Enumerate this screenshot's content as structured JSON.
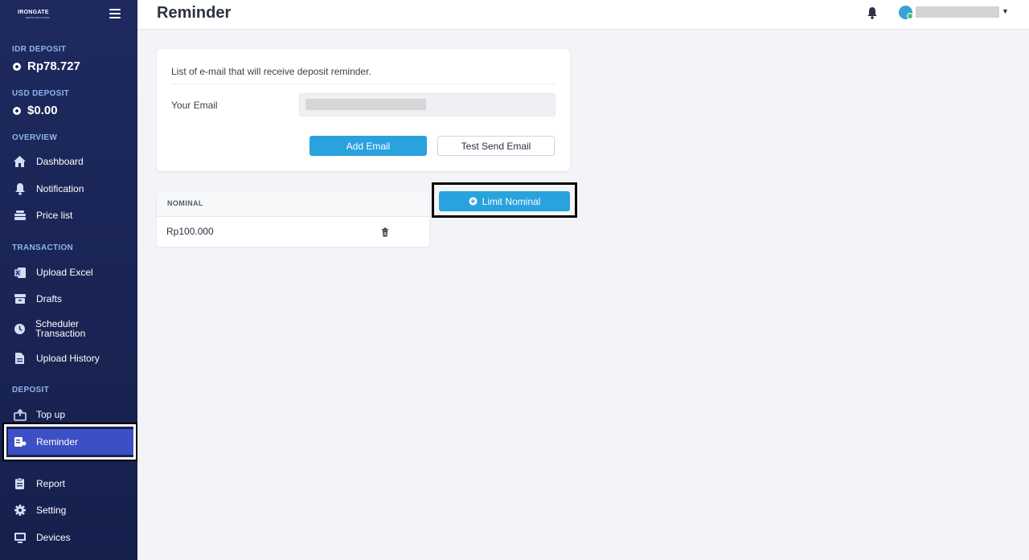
{
  "brand": {
    "name": "IRONGATE",
    "tagline": "DIGITAL SOLUTIONS"
  },
  "sidebar": {
    "idr": {
      "label": "IDR DEPOSIT",
      "amount": "Rp78.727"
    },
    "usd": {
      "label": "USD DEPOSIT",
      "amount": "$0.00"
    },
    "sections": {
      "overview": "OVERVIEW",
      "transaction": "TRANSACTION",
      "deposit": "DEPOSIT"
    },
    "items": [
      {
        "label": "Dashboard",
        "icon": "home-icon"
      },
      {
        "label": "Notification",
        "icon": "bell-icon"
      },
      {
        "label": "Price list",
        "icon": "layers-icon"
      },
      {
        "label": "Upload Excel",
        "icon": "excel-icon"
      },
      {
        "label": "Drafts",
        "icon": "archive-icon"
      },
      {
        "label": "Scheduler Transaction",
        "icon": "clock-icon"
      },
      {
        "label": "Upload History",
        "icon": "document-icon"
      },
      {
        "label": "Top up",
        "icon": "topup-icon"
      },
      {
        "label": "Reminder",
        "icon": "reminder-icon",
        "active": true
      },
      {
        "label": "Report",
        "icon": "clipboard-icon"
      },
      {
        "label": "Setting",
        "icon": "gear-icon"
      },
      {
        "label": "Devices",
        "icon": "monitor-icon"
      }
    ]
  },
  "header": {
    "title": "Reminder"
  },
  "reminder_card": {
    "description": "List of e-mail that will receive deposit reminder.",
    "email_label": "Your Email",
    "add_email_label": "Add Email",
    "test_send_label": "Test Send Email"
  },
  "limit_button": {
    "label": "Limit Nominal"
  },
  "nominal_table": {
    "header": "NOMINAL",
    "rows": [
      {
        "value": "Rp100.000"
      }
    ]
  },
  "colors": {
    "sidebar": "#1e2a5e",
    "accent": "#2aa2de",
    "active": "#3b50c4"
  }
}
